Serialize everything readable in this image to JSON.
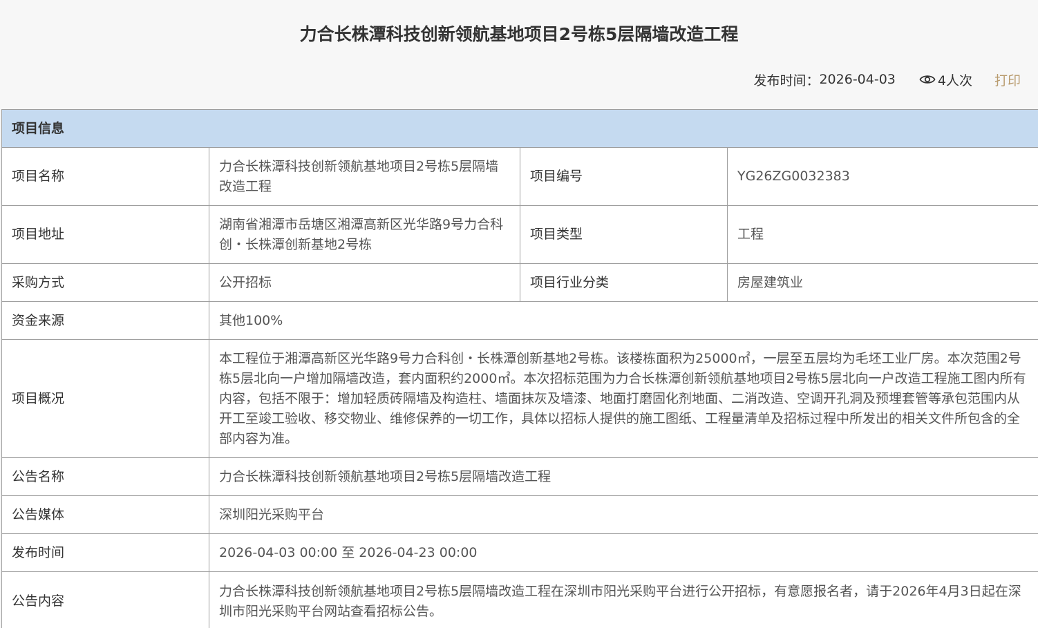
{
  "page_title": "力合长株潭科技创新领航基地项目2号栋5层隔墙改造工程",
  "meta": {
    "publish_label": "发布时间：",
    "publish_date": "2026-04-03",
    "views": "4人次",
    "print_label": "打印"
  },
  "section": {
    "title": "项目信息"
  },
  "fields": {
    "project_name_label": "项目名称",
    "project_name": "力合长株潭科技创新领航基地项目2号栋5层隔墙改造工程",
    "project_code_label": "项目编号",
    "project_code": "YG26ZG0032383",
    "project_address_label": "项目地址",
    "project_address": "湖南省湘潭市岳塘区湘潭高新区光华路9号力合科创・长株潭创新基地2号栋",
    "project_type_label": "项目类型",
    "project_type": "工程",
    "procurement_label": "采购方式",
    "procurement": "公开招标",
    "industry_label": "项目行业分类",
    "industry": "房屋建筑业",
    "funding_label": "资金来源",
    "funding": "其他100%",
    "overview_label": "项目概况",
    "overview": "本工程位于湘潭高新区光华路9号力合科创・长株潭创新基地2号栋。该楼栋面积为25000㎡，一层至五层均为毛坯工业厂房。本次范围2号栋5层北向一户增加隔墙改造，套内面积约2000㎡。本次招标范围为力合长株潭创新领航基地项目2号栋5层北向一户改造工程施工图内所有内容，包括不限于：增加轻质砖隔墙及构造柱、墙面抹灰及墙漆、地面打磨固化剂地面、二消改造、空调开孔洞及预埋套管等承包范围内从开工至竣工验收、移交物业、维修保养的一切工作，具体以招标人提供的施工图纸、工程量清单及招标过程中所发出的相关文件所包含的全部内容为准。",
    "notice_name_label": "公告名称",
    "notice_name": "力合长株潭科技创新领航基地项目2号栋5层隔墙改造工程",
    "notice_media_label": "公告媒体",
    "notice_media": "深圳阳光采购平台",
    "publish_time_label": "发布时间",
    "publish_time": "2026-04-03 00:00 至 2026-04-23 00:00",
    "notice_content_label": "公告内容",
    "notice_content": "力合长株潭科技创新领航基地项目2号栋5层隔墙改造工程在深圳市阳光采购平台进行公开招标，有意愿报名者，请于2026年4月3日起在深圳市阳光采购平台网站查看招标公告。"
  },
  "colors": {
    "section_header_bg": "#c5daf0",
    "print_link": "#b89b6e",
    "border": "#9e9e9e"
  }
}
